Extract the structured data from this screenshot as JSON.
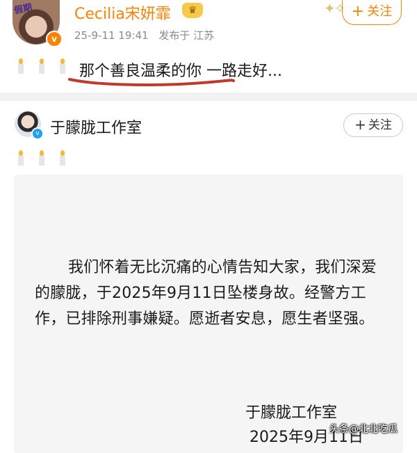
{
  "post1": {
    "avatar_sticker": "假期",
    "username": "Cecilia宋妍霏",
    "verified_badge": "v",
    "level_icon": "crown-icon",
    "time": "25-9-11 19:41",
    "published_in": "发布于 江苏",
    "follow_plus": "+",
    "follow_label": "关注",
    "text": "那个善良温柔的你 一路走好...",
    "accent_color": "#ff8200",
    "underline_color": "#c0392b"
  },
  "post2": {
    "username": "于朦胧工作室",
    "verified_badge": "v",
    "follow_plus": "+",
    "follow_label": "关注",
    "statement": "我们怀着无比沉痛的心情告知大家，我们深爱的朦胧，于2025年9月11日坠楼身故。经警方工作，已排除刑事嫌疑。愿逝者安息，愿生者坚强。",
    "signature": "于朦胧工作室",
    "date": "2025年9月11日"
  },
  "watermark": "头条@北北吃瓜"
}
